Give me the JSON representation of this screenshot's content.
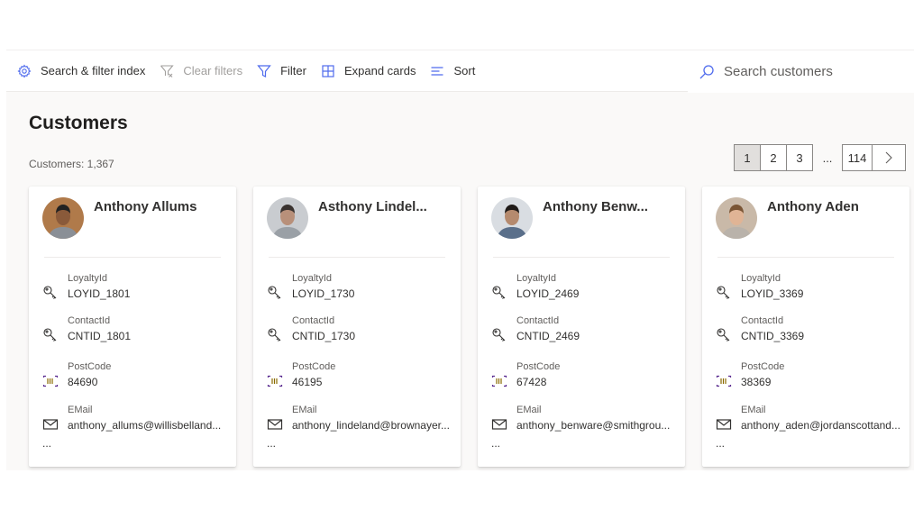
{
  "toolbar": {
    "items": [
      {
        "label": "Search & filter index",
        "icon": "gear-icon",
        "enabled": true
      },
      {
        "label": "Clear filters",
        "icon": "clear-filter-icon",
        "enabled": false
      },
      {
        "label": "Filter",
        "icon": "filter-icon",
        "enabled": true
      },
      {
        "label": "Expand cards",
        "icon": "grid-icon",
        "enabled": true
      },
      {
        "label": "Sort",
        "icon": "sort-icon",
        "enabled": true
      }
    ],
    "search": {
      "placeholder": "Search customers",
      "value": "",
      "icon": "search-icon"
    }
  },
  "page": {
    "title": "Customers",
    "count_label": "Customers: 1,367"
  },
  "pagination": {
    "pages": [
      "1",
      "2",
      "3"
    ],
    "current": "1",
    "ellipsis": "...",
    "last": "114",
    "next_icon": "chevron-right-icon"
  },
  "field_labels": {
    "loyalty": "LoyaltyId",
    "contact": "ContactId",
    "postcode": "PostCode",
    "email": "EMail"
  },
  "colors": {
    "accent": "#4f6bed",
    "postcode_icon": "#5c2e91",
    "background": "#faf9f8"
  },
  "cards": [
    {
      "name": "Anthony Allums",
      "loyalty": "LOYID_1801",
      "contact": "CNTID_1801",
      "postcode": "84690",
      "email": "anthony_allums@willisbelland...",
      "more": "..."
    },
    {
      "name": "Asthony Lindel...",
      "loyalty": "LOYID_1730",
      "contact": "CNTID_1730",
      "postcode": "46195",
      "email": "anthony_lindeland@brownayer...",
      "more": "..."
    },
    {
      "name": "Anthony Benw...",
      "loyalty": "LOYID_2469",
      "contact": "CNTID_2469",
      "postcode": "67428",
      "email": "anthony_benware@smithgrou...",
      "more": "..."
    },
    {
      "name": "Anthony Aden",
      "loyalty": "LOYID_3369",
      "contact": "CNTID_3369",
      "postcode": "38369",
      "email": "anthony_aden@jordanscottand...",
      "more": "..."
    }
  ]
}
